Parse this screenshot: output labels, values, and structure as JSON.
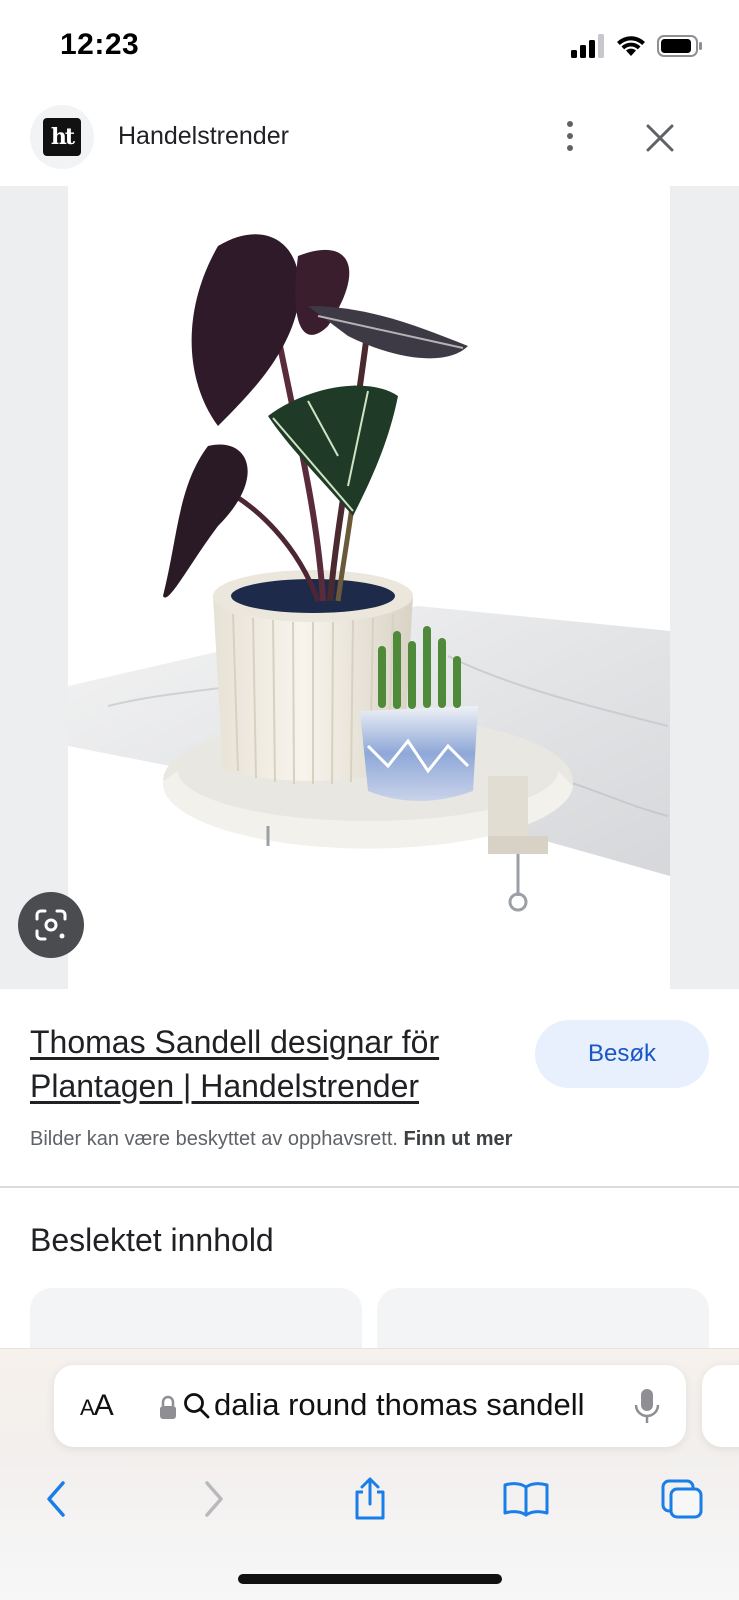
{
  "status_bar": {
    "time": "12:23"
  },
  "header": {
    "site_name": "Handelstrender",
    "logo_text": "ht"
  },
  "image": {
    "icon": "google-lens-icon"
  },
  "result": {
    "title": "Thomas Sandell designar för Plantagen | Handelstrender",
    "visit_label": "Besøk",
    "copyright_text": "Bilder kan være beskyttet av opphavsrett.",
    "learn_more": "Finn ut mer"
  },
  "related": {
    "heading": "Beslektet innhold"
  },
  "browser": {
    "text_size_label_small": "A",
    "text_size_label_large": "A",
    "address_text": "dalia round thomas sandell"
  },
  "colors": {
    "accent": "#1a73e8",
    "safari_blue": "#1a7ee8",
    "visit_bg": "#e8f0fe"
  }
}
